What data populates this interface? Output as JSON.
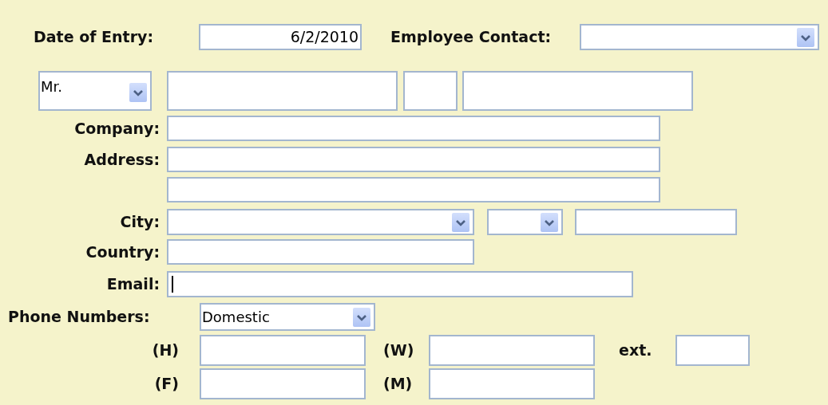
{
  "date_of_entry": {
    "label": "Date of Entry:",
    "value": "6/2/2010"
  },
  "employee_contact": {
    "label": "Employee Contact:"
  },
  "name": {
    "salutation": "Mr."
  },
  "company": {
    "label": "Company:"
  },
  "address": {
    "label": "Address:"
  },
  "city": {
    "label": "City:"
  },
  "country": {
    "label": "Country:"
  },
  "email": {
    "label": "Email:",
    "focused": true
  },
  "phone_numbers": {
    "label": "Phone Numbers:",
    "type": "Domestic",
    "home": {
      "label": "(H)"
    },
    "work": {
      "label": "(W)"
    },
    "ext": {
      "label": "ext."
    },
    "fax": {
      "label": "(F)"
    },
    "mobile": {
      "label": "(M)"
    }
  }
}
